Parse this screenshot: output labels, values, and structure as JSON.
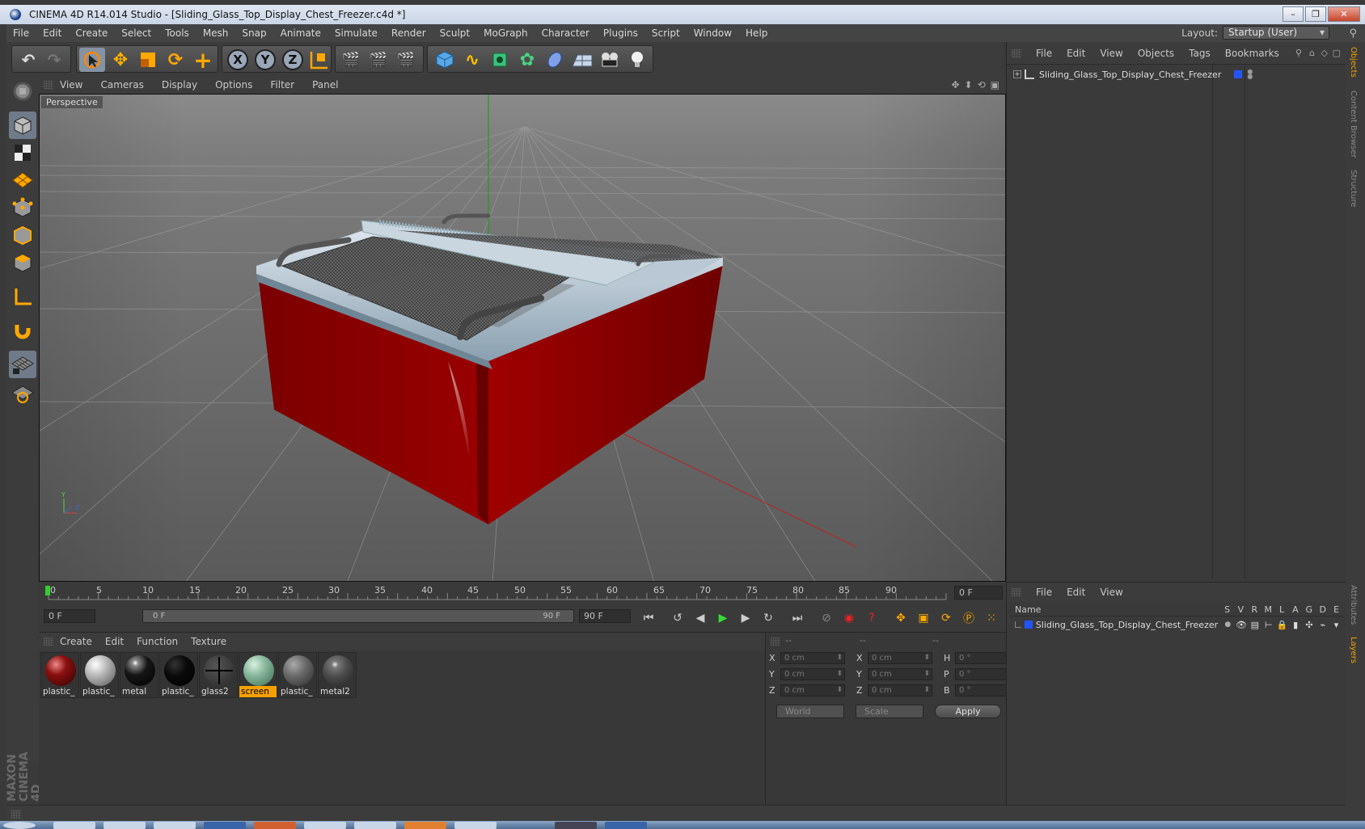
{
  "window": {
    "title": "CINEMA 4D R14.014 Studio - [Sliding_Glass_Top_Display_Chest_Freezer.c4d *]"
  },
  "menu": [
    "File",
    "Edit",
    "Create",
    "Select",
    "Tools",
    "Mesh",
    "Snap",
    "Animate",
    "Simulate",
    "Render",
    "Sculpt",
    "MoGraph",
    "Character",
    "Plugins",
    "Script",
    "Window",
    "Help"
  ],
  "layout": {
    "label": "Layout:",
    "value": "Startup (User)"
  },
  "viewport": {
    "menu": [
      "View",
      "Cameras",
      "Display",
      "Options",
      "Filter",
      "Panel"
    ],
    "label": "Perspective"
  },
  "timeline": {
    "ticks": [
      "0",
      "5",
      "10",
      "15",
      "20",
      "25",
      "30",
      "35",
      "40",
      "45",
      "50",
      "55",
      "60",
      "65",
      "70",
      "75",
      "80",
      "85",
      "90"
    ],
    "frame_end": "0 F"
  },
  "transport": {
    "start": "0 F",
    "slider_left": "0 F",
    "slider_right": "90 F",
    "end": "90 F"
  },
  "materials": {
    "menu": [
      "Create",
      "Edit",
      "Function",
      "Texture"
    ],
    "items": [
      {
        "label": "plastic_",
        "color": "#8b1010"
      },
      {
        "label": "plastic_",
        "color": "#b5b5b5"
      },
      {
        "label": "metal",
        "color": "#161616"
      },
      {
        "label": "plastic_",
        "color": "#0a0a0a"
      },
      {
        "label": "glass2",
        "color": "#3a3a3a"
      },
      {
        "label": "screen",
        "color": "#87b59a"
      },
      {
        "label": "plastic_",
        "color": "#6a6a6a"
      },
      {
        "label": "metal2",
        "color": "#4a4a4a"
      }
    ]
  },
  "coords": {
    "headers": [
      "--",
      "--",
      "--"
    ],
    "rows": [
      {
        "a1": "X",
        "v1": "0 cm",
        "a2": "X",
        "v2": "0 cm",
        "a3": "H",
        "v3": "0 °"
      },
      {
        "a1": "Y",
        "v1": "0 cm",
        "a2": "Y",
        "v2": "0 cm",
        "a3": "P",
        "v3": "0 °"
      },
      {
        "a1": "Z",
        "v1": "0 cm",
        "a2": "Z",
        "v2": "0 cm",
        "a3": "B",
        "v3": "0 °"
      }
    ],
    "world": "World",
    "scale": "Scale",
    "apply": "Apply"
  },
  "objects": {
    "menu": [
      "File",
      "Edit",
      "View",
      "Objects",
      "Tags",
      "Bookmarks"
    ],
    "item": "Sliding_Glass_Top_Display_Chest_Freezer"
  },
  "layers": {
    "menu": [
      "File",
      "Edit",
      "View"
    ],
    "name_header": "Name",
    "cols": [
      "S",
      "V",
      "R",
      "M",
      "L",
      "A",
      "G",
      "D",
      "E"
    ],
    "item": "Sliding_Glass_Top_Display_Chest_Freezer"
  },
  "sidetabs": [
    "Objects",
    "Content Browser",
    "Structure",
    "Attributes",
    "Layers"
  ],
  "branding": "MAXON CINEMA 4D"
}
